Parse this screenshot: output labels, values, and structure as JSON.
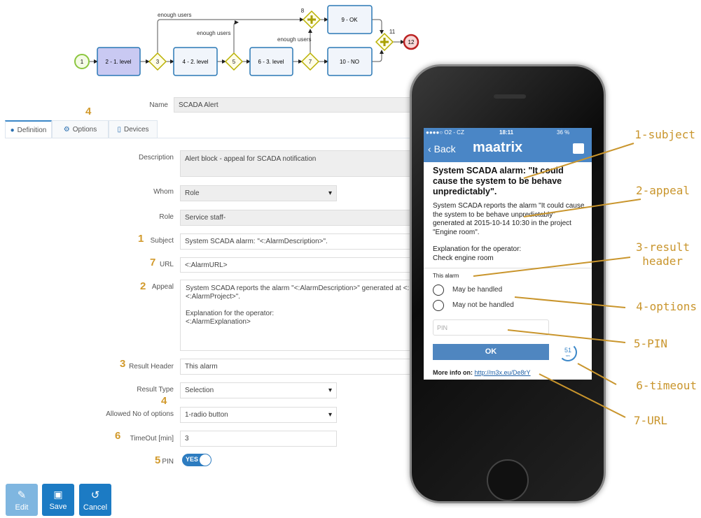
{
  "diagram": {
    "nodes": {
      "n1": "1",
      "n2": "2 - 1. level",
      "n3": "3",
      "n4": "4 - 2. level",
      "n5": "5",
      "n6": "6 - 3. level",
      "n7": "7",
      "n8": "8",
      "n9": "9 - OK",
      "n10": "10 - NO",
      "n11": "11",
      "n12": "12"
    },
    "edge_labels": [
      "enough users",
      "enough users",
      "enough users"
    ]
  },
  "form": {
    "name": {
      "label": "Name",
      "value": "SCADA Alert"
    },
    "tabs": [
      {
        "label": "Definition",
        "icon": "info-icon",
        "active": true
      },
      {
        "label": "Options",
        "icon": "gear-icon"
      },
      {
        "label": "Devices",
        "icon": "mobile-icon"
      }
    ],
    "description": {
      "label": "Description",
      "value": "Alert block - appeal for SCADA notification"
    },
    "whom": {
      "label": "Whom",
      "value": "Role"
    },
    "role": {
      "label": "Role",
      "value": "Service staff-"
    },
    "subject": {
      "label": "Subject",
      "value": "System SCADA alarm: \"<:AlarmDescription>\"."
    },
    "url": {
      "label": "URL",
      "value": "<:AlarmURL>"
    },
    "appeal": {
      "label": "Appeal",
      "line1": "System SCADA reports the alarm \"<:AlarmDescription>\" generated at <:",
      "line2": "<:AlarmProject>\".",
      "line3": "Explanation for the operator:",
      "line4": "<:AlarmExplanation>"
    },
    "result_header": {
      "label": "Result Header",
      "value": "This alarm"
    },
    "result_type": {
      "label": "Result Type",
      "value": "Selection"
    },
    "allowed": {
      "label": "Allowed No of options",
      "value": "1-radio button"
    },
    "timeout": {
      "label": "TimeOut [min]",
      "value": "3"
    },
    "pin": {
      "label": "PIN",
      "value": "YES",
      "on": true
    },
    "markers": {
      "options_tab": "4",
      "subject": "1",
      "url": "7",
      "appeal": "2",
      "result_header": "3",
      "result_type": "4",
      "timeout": "6",
      "pin": "5"
    }
  },
  "buttons": {
    "edit": "Edit",
    "save": "Save",
    "cancel": "Cancel"
  },
  "phone": {
    "status": {
      "carrier": "●●●●○ O2 - CZ",
      "time": "18:11",
      "battery": "36 %"
    },
    "nav": {
      "back": "Back",
      "logo": "maatrix"
    },
    "title": "System SCADA alarm: \"It could cause the system to be behave unpredictably\".",
    "body": "System SCADA reports the alarm \"It could cause the system to be behave unpredictably\" generated at 2015-10-14 10:30 in the project \"Engine room\".",
    "explanation_label": "Explanation for the operator:",
    "explanation": "Check engine room",
    "result_header": "This alarm",
    "options": [
      "May be handled",
      "May not be handled"
    ],
    "pin_placeholder": "PIN",
    "ok": "OK",
    "timeout": "51",
    "timeout_unit": "sec",
    "more_info": "More info on:",
    "link": "http://m3x.eu/De8rY"
  },
  "annotations": [
    "1-subject",
    "2-appeal",
    "3-result",
    "header",
    "4-options",
    "5-PIN",
    "6-timeout",
    "7-URL"
  ],
  "colors": {
    "accent": "#1c7bc4",
    "annotation": "#c9952c",
    "phone_blue": "#4a86c6"
  }
}
